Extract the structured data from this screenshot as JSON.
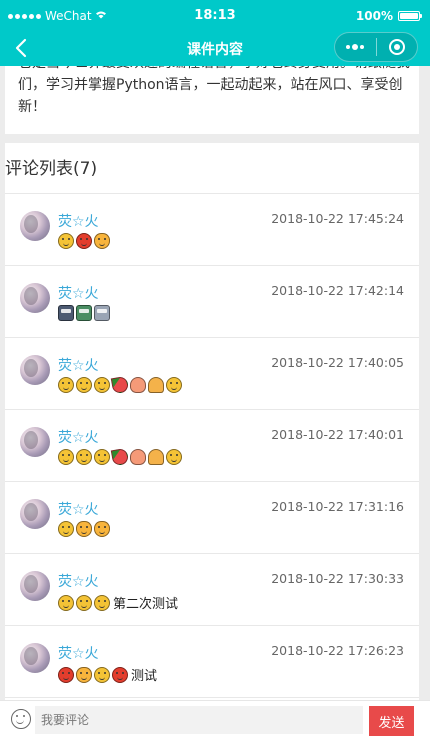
{
  "status_bar": {
    "carrier": "WeChat",
    "time": "18:13",
    "battery": "100%"
  },
  "nav": {
    "title": "课件内容"
  },
  "intro": {
    "text": "它是当今世界最受欢迎的编程语言，学好它终身受用。请跟随我们，学习并掌握Python语言，一起动起来，站在风口、享受创新！"
  },
  "comments": {
    "header": "评论列表(7)",
    "items": [
      {
        "user": "荧☆火",
        "time": "2018-10-22 17:45:24",
        "emojis": [
          "face",
          "angry",
          "cat"
        ],
        "text": ""
      },
      {
        "user": "荧☆火",
        "time": "2018-10-22 17:42:14",
        "emojis": [
          "train",
          "rail",
          "bus"
        ],
        "text": ""
      },
      {
        "user": "荧☆火",
        "time": "2018-10-22 17:40:05",
        "emojis": [
          "face",
          "face",
          "face",
          "melon",
          "peach",
          "pray",
          "face"
        ],
        "text": ""
      },
      {
        "user": "荧☆火",
        "time": "2018-10-22 17:40:01",
        "emojis": [
          "face",
          "face",
          "face",
          "melon",
          "peach",
          "pray",
          "face"
        ],
        "text": ""
      },
      {
        "user": "荧☆火",
        "time": "2018-10-22 17:31:16",
        "emojis": [
          "face",
          "cat",
          "cat"
        ],
        "text": ""
      },
      {
        "user": "荧☆火",
        "time": "2018-10-22 17:30:33",
        "emojis": [
          "face",
          "face",
          "face"
        ],
        "text": "第二次测试"
      },
      {
        "user": "荧☆火",
        "time": "2018-10-22 17:26:23",
        "emojis": [
          "angry",
          "cat",
          "face",
          "angry"
        ],
        "text": "测试"
      }
    ]
  },
  "input_bar": {
    "placeholder": "我要评论",
    "send_label": "发送"
  },
  "colors": {
    "header_bg": "#00c9c9",
    "username": "#3aa8d8",
    "send_button": "#e84a4a"
  }
}
